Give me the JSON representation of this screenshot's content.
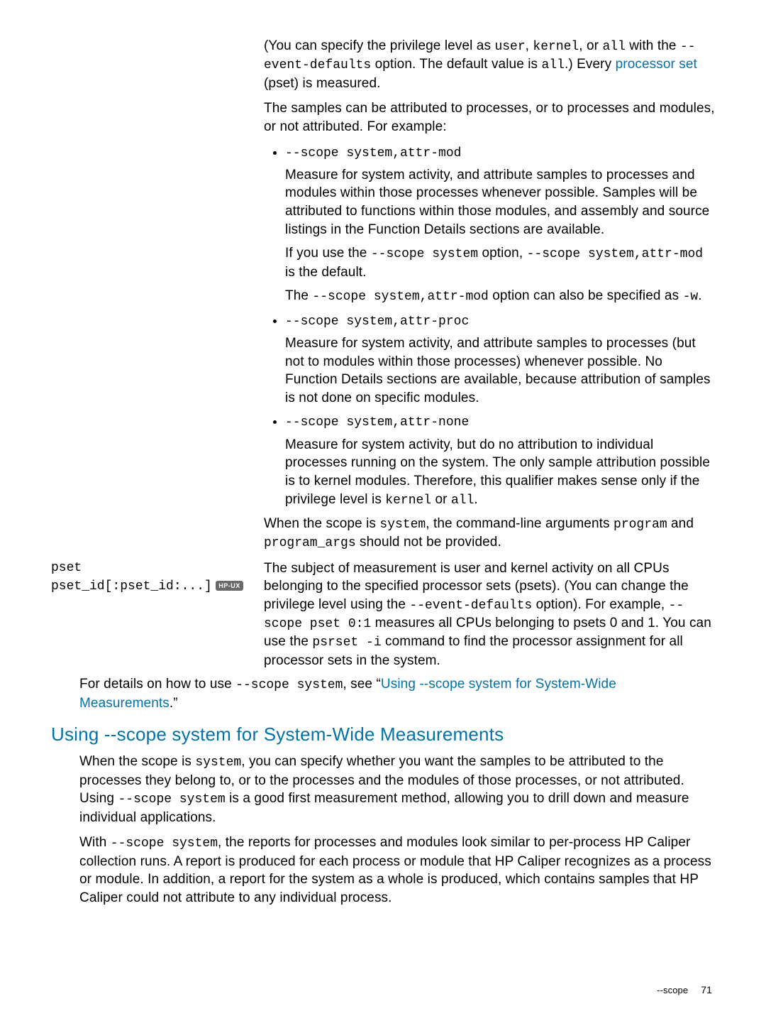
{
  "intro": {
    "p1a": "(You can specify the privilege level as ",
    "p1b": ", ",
    "p1c": ", or ",
    "p1d": " with the ",
    "p1e": " option. The default value is ",
    "p1f": ".) Every ",
    "p1g": " (pset) is measured.",
    "c_user": "user",
    "c_kernel": "kernel",
    "c_all": "all",
    "c_ed": "--event-defaults",
    "c_all2": "all",
    "link_pset": "processor set",
    "p2": "The samples can be attributed to processes, or to processes and modules, or not attributed. For example:"
  },
  "b1": {
    "cmd": "--scope system,attr-mod",
    "p1": "Measure for system activity, and attribute samples to processes and modules within those processes whenever possible. Samples will be attributed to functions within those modules, and assembly and source listings in the Function Details sections are available.",
    "p2a": "If you use the ",
    "p2b": " option, ",
    "p2c": " is the default.",
    "c1": "--scope system",
    "c2": "--scope system,attr-mod",
    "p3a": "The ",
    "p3b": " option can also be specified as ",
    "p3c": ".",
    "c3": "--scope system,attr-mod",
    "c4": "-w"
  },
  "b2": {
    "cmd": "--scope system,attr-proc",
    "p1": "Measure for system activity, and attribute samples to processes (but not to modules within those processes) whenever possible. No Function Details sections are available, because attribution of samples is not done on specific modules."
  },
  "b3": {
    "cmd": "--scope system,attr-none",
    "p1a": "Measure for system activity, but do no attribution to individual processes running on the system. The only sample attribution possible is to kernel modules. Therefore, this qualifier makes sense only if the privilege level is ",
    "p1b": " or ",
    "p1c": ".",
    "c1": "kernel",
    "c2": "all"
  },
  "after_bullets": {
    "a": "When the scope is ",
    "b": ", the command-line arguments ",
    "c": " and ",
    "d": " should not be provided.",
    "c_system": "system",
    "c_program": "program",
    "c_args": "program_args"
  },
  "pset_row": {
    "left_l1": "pset",
    "left_l2": "pset_id[:pset_id:...]",
    "badge": "HP-UX",
    "r_a": "The subject of measurement is user and kernel activity on all CPUs belonging to the specified processor sets (psets). (You can change the privilege level using the ",
    "r_b": " option). For example, ",
    "r_c": " measures all CPUs belonging to psets 0 and 1. You can use the ",
    "r_d": " command to find the processor assignment for all processor sets in the system.",
    "c_ed": "--event-defaults",
    "c_scope": "--scope pset 0:1",
    "c_psrset": "psrset -i"
  },
  "see_also": {
    "a": "For details on how to use ",
    "b": ", see “",
    "c": ".”",
    "c_scope": "--scope system",
    "link": "Using --scope system for System-Wide Measurements"
  },
  "heading": "Using --scope system for System-Wide Measurements",
  "body": {
    "p1a": "When the scope is ",
    "p1b": ", you can specify whether you want the samples to be attributed to the processes they belong to, or to the processes and the modules of those processes, or not attributed. Using ",
    "p1c": " is a good first measurement method, allowing you to drill down and measure individual applications.",
    "c_system": "system",
    "c_scope": "--scope system",
    "p2a": "With ",
    "p2b": ", the reports for processes and modules look similar to per-process HP Caliper collection runs. A report is produced for each process or module that HP Caliper recognizes as a process or module. In addition, a report for the system as a whole is produced, which contains samples that HP Caliper could not attribute to any individual process.",
    "c_scope2": "--scope system"
  },
  "footer": {
    "label": "--scope",
    "page": "71"
  }
}
